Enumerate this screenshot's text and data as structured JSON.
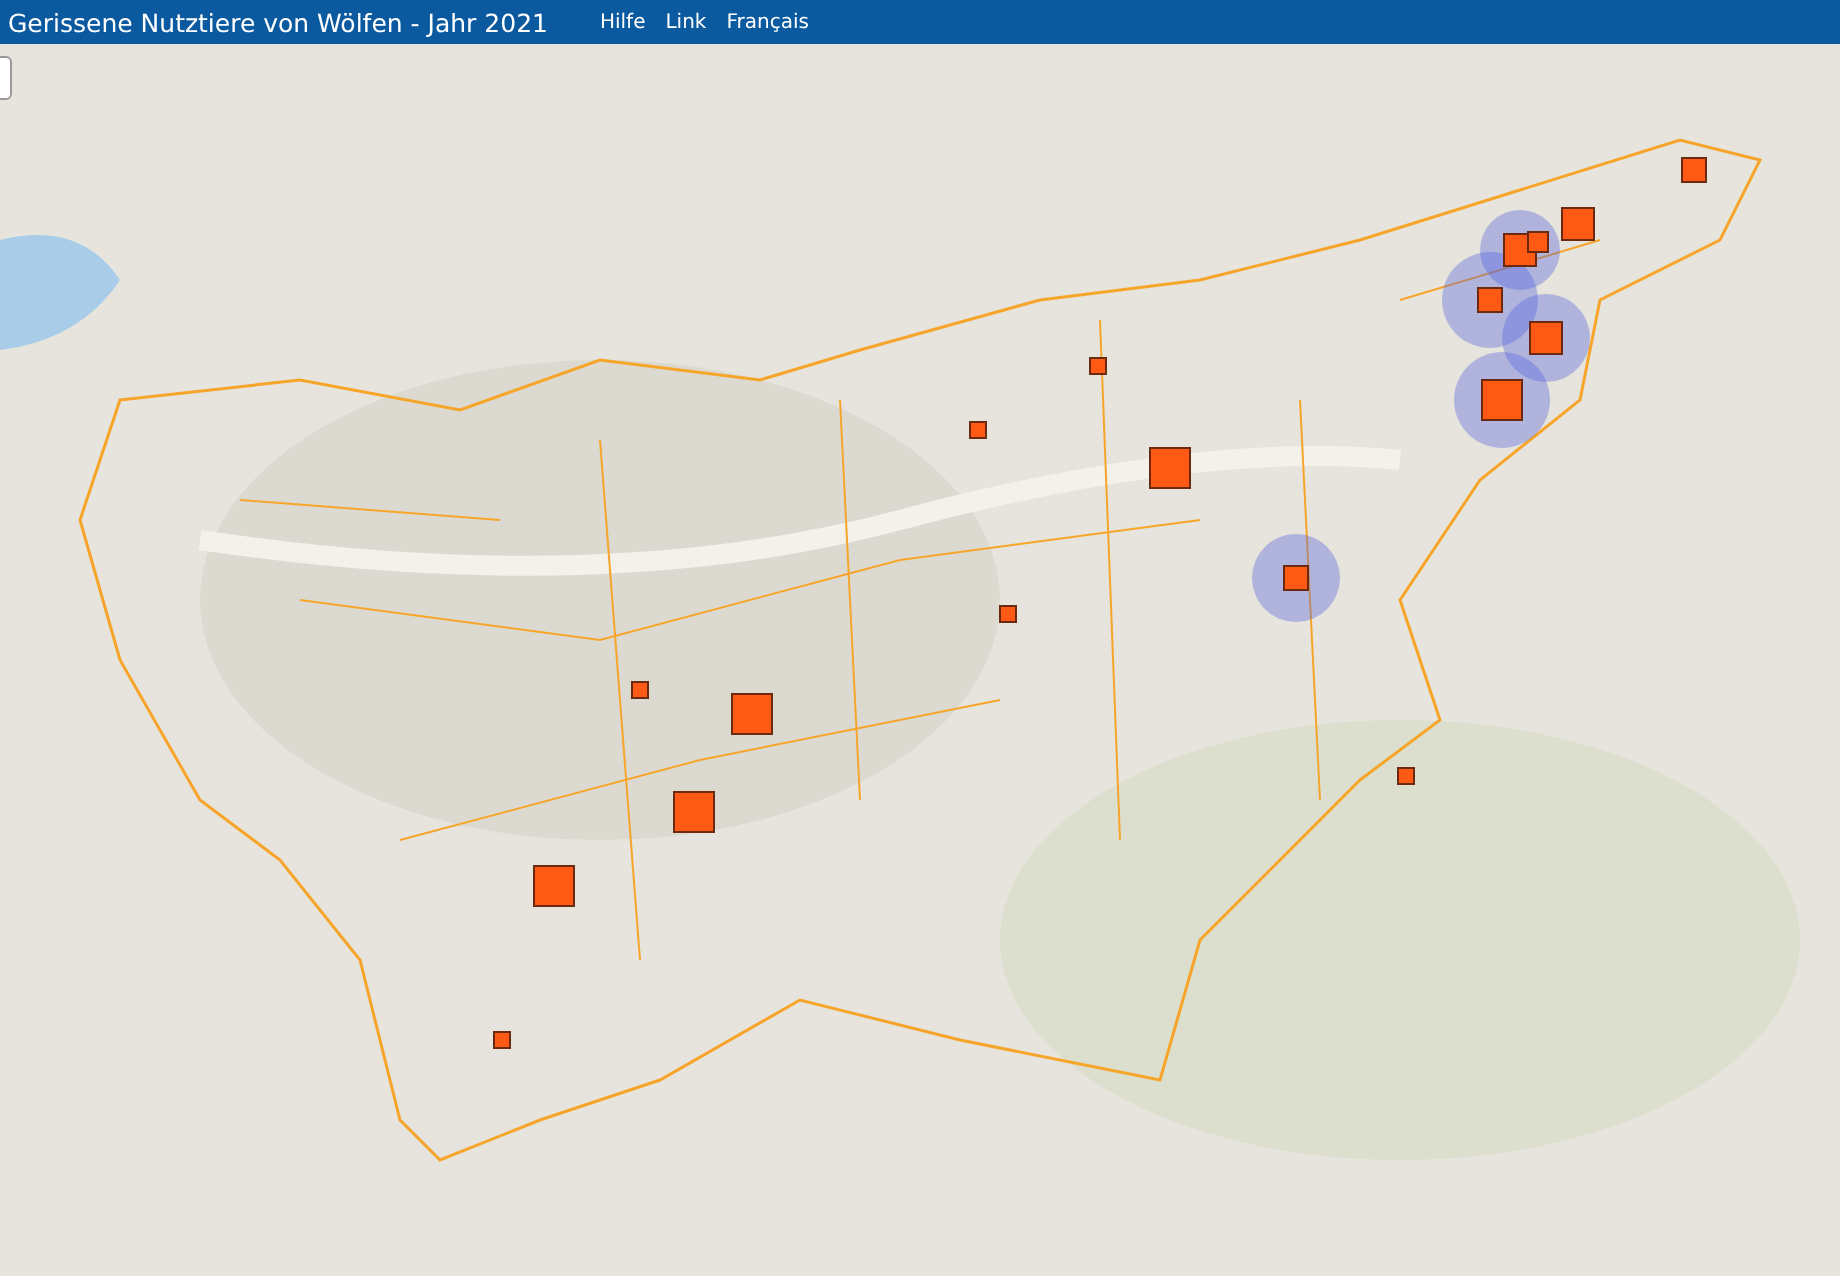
{
  "header": {
    "title": "Gerissene Nutztiere von Wölfen - Jahr 2021",
    "links": [
      "Hilfe",
      "Link",
      "Français"
    ]
  }
}
